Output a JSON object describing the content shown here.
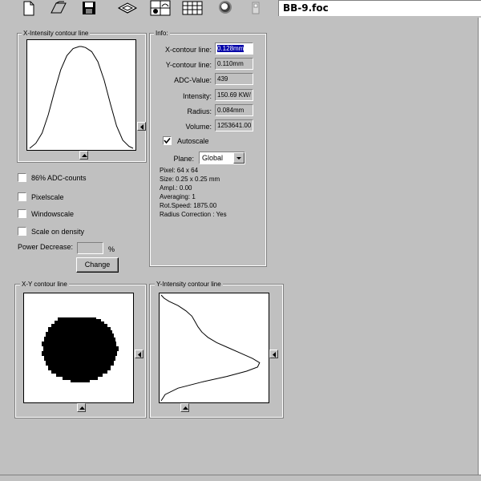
{
  "toolbar": {
    "buttons": [
      {
        "icon": "new-document-icon"
      },
      {
        "icon": "open-folder-icon"
      },
      {
        "icon": "save-disk-icon"
      },
      {
        "icon": "3d-view-icon"
      },
      {
        "icon": "split-view-icon"
      },
      {
        "icon": "data-table-icon"
      },
      {
        "icon": "circle-spot-icon"
      },
      {
        "icon": "device-icon"
      }
    ],
    "filename": "BB-9.foc"
  },
  "x_panel": {
    "title": "X-Intensity contour line"
  },
  "info": {
    "title": "Info:",
    "fields": [
      {
        "label": "X-contour line:",
        "value": "0.128mm"
      },
      {
        "label": "Y-contour line:",
        "value": "0.110mm"
      },
      {
        "label": "ADC-Value:",
        "value": "439"
      },
      {
        "label": "Intensity:",
        "value": "150.69 KW/"
      },
      {
        "label": "Radius:",
        "value": "0.084mm"
      },
      {
        "label": "Volume:",
        "value": "1253641.00"
      }
    ],
    "autoscale_label": "Autoscale",
    "autoscale_checked": true,
    "plane_label": "Plane:",
    "plane_value": "Global",
    "lines": [
      "Pixel:  64 x 64",
      "Size: 0.25 x 0.25 mm",
      "Ampl.: 0.00",
      "Averaging: 1",
      "Rot.Speed:  1875.00",
      "Radius Correction : Yes"
    ]
  },
  "options": {
    "adc_label": "86% ADC-counts",
    "pixelscale_label": "Pixelscale",
    "windowscale_label": "Windowscale",
    "density_label": "Scale on density",
    "power_label": "Power Decrease:",
    "power_value": "",
    "power_unit": "%",
    "change_label": "Change"
  },
  "xy_panel": {
    "title": "X-Y contour line"
  },
  "y_panel": {
    "title": "Y-Intensity contour line"
  },
  "chart_data": [
    {
      "type": "line",
      "name": "x-intensity",
      "x": [
        0,
        0.06,
        0.12,
        0.18,
        0.24,
        0.3,
        0.36,
        0.42,
        0.48,
        0.5,
        0.54,
        0.6,
        0.66,
        0.72,
        0.78,
        0.84,
        0.9,
        0.96,
        1.0
      ],
      "values": [
        0.0,
        0.05,
        0.15,
        0.33,
        0.56,
        0.77,
        0.91,
        0.98,
        1.0,
        1.0,
        0.99,
        0.95,
        0.85,
        0.67,
        0.44,
        0.22,
        0.08,
        0.02,
        0.0
      ]
    },
    {
      "type": "line",
      "name": "y-intensity",
      "x": [
        0,
        0.03,
        0.06,
        0.1,
        0.15,
        0.2,
        0.25,
        0.3,
        0.35,
        0.4,
        0.45,
        0.5,
        0.55,
        0.6,
        0.64,
        0.68,
        0.72,
        0.77,
        0.82,
        0.88,
        0.94,
        1.0
      ],
      "values": [
        0.0,
        0.03,
        0.08,
        0.17,
        0.25,
        0.31,
        0.34,
        0.37,
        0.41,
        0.47,
        0.56,
        0.68,
        0.8,
        0.92,
        0.99,
        0.97,
        0.86,
        0.66,
        0.42,
        0.17,
        0.04,
        0.0
      ]
    }
  ]
}
